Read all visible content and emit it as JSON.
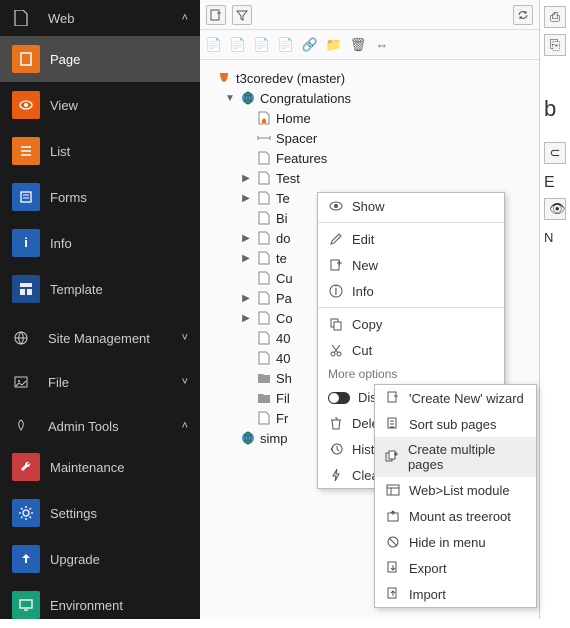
{
  "sidebar": {
    "groups": [
      {
        "label": "Web",
        "expanded": true,
        "items": [
          {
            "label": "Page",
            "active": true,
            "color": "icon-orange"
          },
          {
            "label": "View",
            "color": "icon-orange2"
          },
          {
            "label": "List",
            "color": "icon-orange"
          },
          {
            "label": "Forms",
            "color": "icon-blue"
          },
          {
            "label": "Info",
            "color": "icon-blue"
          },
          {
            "label": "Template",
            "color": "icon-darkblue"
          }
        ]
      },
      {
        "label": "Site Management",
        "expanded": false,
        "items": []
      },
      {
        "label": "File",
        "expanded": false,
        "items": []
      },
      {
        "label": "Admin Tools",
        "expanded": true,
        "items": [
          {
            "label": "Maintenance",
            "color": "icon-red"
          },
          {
            "label": "Settings",
            "color": "icon-blue"
          },
          {
            "label": "Upgrade",
            "color": "icon-blue"
          },
          {
            "label": "Environment",
            "color": "icon-teal"
          }
        ]
      }
    ]
  },
  "tree": {
    "root": "t3coredev (master)",
    "nodes": [
      {
        "label": "Congratulations",
        "indent": 1,
        "toggle": "▼",
        "icon": "globe"
      },
      {
        "label": "Home",
        "indent": 2,
        "icon": "page-home"
      },
      {
        "label": "Spacer",
        "indent": 2,
        "icon": "spacer"
      },
      {
        "label": "Features",
        "indent": 2,
        "icon": "page"
      },
      {
        "label": "Test",
        "indent": 2,
        "toggle": "▶",
        "icon": "page"
      },
      {
        "label": "Te",
        "indent": 2,
        "toggle": "▶",
        "icon": "page"
      },
      {
        "label": "Bi",
        "indent": 2,
        "icon": "page"
      },
      {
        "label": "do",
        "indent": 2,
        "toggle": "▶",
        "icon": "page"
      },
      {
        "label": "te",
        "indent": 2,
        "toggle": "▶",
        "icon": "page"
      },
      {
        "label": "Cu",
        "indent": 2,
        "icon": "page"
      },
      {
        "label": "Pa",
        "indent": 2,
        "toggle": "▶",
        "icon": "page"
      },
      {
        "label": "Co",
        "indent": 2,
        "toggle": "▶",
        "icon": "page"
      },
      {
        "label": "40",
        "indent": 2,
        "icon": "page"
      },
      {
        "label": "40",
        "indent": 2,
        "icon": "page"
      },
      {
        "label": "Sh",
        "indent": 2,
        "icon": "folder"
      },
      {
        "label": "Fil",
        "indent": 2,
        "icon": "folder"
      },
      {
        "label": "Fr",
        "indent": 2,
        "icon": "page"
      },
      {
        "label": "simp",
        "indent": 1,
        "icon": "globe"
      }
    ]
  },
  "context_menu_1": {
    "items": [
      {
        "label": "Show",
        "icon": "eye"
      },
      {
        "sep": true
      },
      {
        "label": "Edit",
        "icon": "pencil"
      },
      {
        "label": "New",
        "icon": "plus"
      },
      {
        "label": "Info",
        "icon": "info"
      },
      {
        "sep": true
      },
      {
        "label": "Copy",
        "icon": "copy"
      },
      {
        "label": "Cut",
        "icon": "cut"
      },
      {
        "heading": "More options"
      },
      {
        "label": "Disab",
        "icon": "toggle"
      },
      {
        "label": "Delet",
        "icon": "trash"
      },
      {
        "label": "Histor",
        "icon": "history"
      },
      {
        "label": "Clear",
        "icon": "bolt"
      }
    ]
  },
  "context_menu_2": {
    "items": [
      {
        "label": "'Create New' wizard",
        "icon": "wiz"
      },
      {
        "label": "Sort sub pages",
        "icon": "sort"
      },
      {
        "label": "Create multiple pages",
        "icon": "multi",
        "highlighted": true
      },
      {
        "label": "Web>List module",
        "icon": "list"
      },
      {
        "label": "Mount as treeroot",
        "icon": "mount"
      },
      {
        "label": "Hide in menu",
        "icon": "hide"
      },
      {
        "label": "Export",
        "icon": "export"
      },
      {
        "label": "Import",
        "icon": "import"
      }
    ]
  },
  "right": {
    "b": "b",
    "E": "E",
    "N": "N"
  }
}
